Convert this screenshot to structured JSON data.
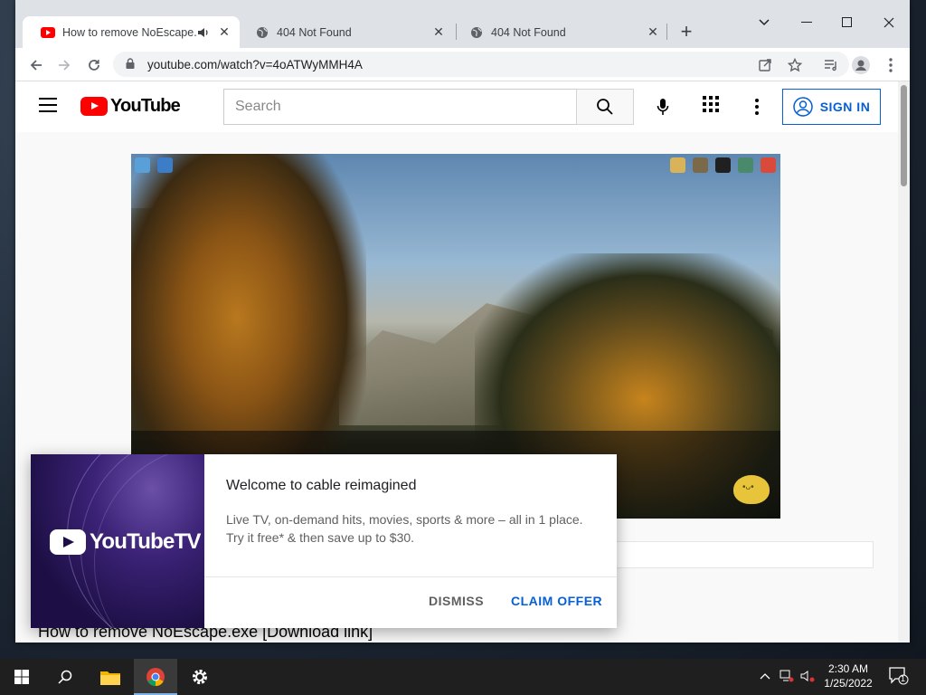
{
  "browser": {
    "tabs": [
      {
        "title": "How to remove NoEscape.ex",
        "active": true
      },
      {
        "title": "404 Not Found",
        "active": false
      },
      {
        "title": "404 Not Found",
        "active": false
      }
    ],
    "url": "youtube.com/watch?v=4oATWyMMH4A"
  },
  "youtube": {
    "logo_text": "YouTube",
    "search_placeholder": "Search",
    "sign_in_label": "SIGN IN",
    "video_title": "How to remove NoEscape.exe [Download link]"
  },
  "popup": {
    "brand": "YouTubeTV",
    "title": "Welcome to cable reimagined",
    "text_line1": "Live TV, on-demand hits, movies, sports & more – all in 1 place.",
    "text_line2": "Try it free* & then save up to $30.",
    "dismiss_label": "DISMISS",
    "claim_label": "CLAIM OFFER"
  },
  "taskbar": {
    "time": "2:30 AM",
    "date": "1/25/2022",
    "notification_count": "1"
  },
  "colors": {
    "youtube_red": "#ff0000",
    "link_blue": "#065fd4",
    "taskbar": "#1f1f1f"
  }
}
